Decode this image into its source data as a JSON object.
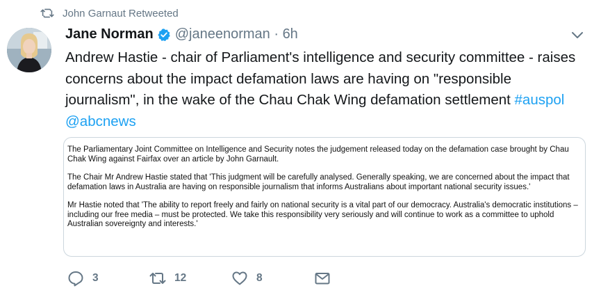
{
  "retweeted_by": "John Garnaut Retweeted",
  "tweet": {
    "author_name": "Jane Norman",
    "handle": "@janeenorman",
    "separator": " · ",
    "time": "6h",
    "text_main": "Andrew Hastie - chair of Parliament's intelligence and security committee - raises concerns about the impact defamation laws are having on \"responsible journalism\", in the wake of the Chau Chak Wing defamation settlement ",
    "hashtag": "#auspol",
    "mention": "@abcnews"
  },
  "quote": {
    "paragraphs": [
      "The Parliamentary Joint Committee on Intelligence and Security notes the judgement released today on the defamation case brought by Chau Chak Wing against Fairfax over an article by John Garnault.",
      "The Chair Mr Andrew Hastie stated that 'This judgment will be carefully analysed. Generally speaking, we are concerned about the impact that defamation laws in Australia are having on responsible journalism that informs Australians about important national security issues.'",
      "Mr Hastie noted that 'The ability to report freely and fairly on national security is a vital part of our democracy. Australia's democratic institutions – including our free media – must be protected. We take this responsibility very seriously and will continue to work as a committee to uphold Australian sovereignty and interests.'"
    ]
  },
  "actions": {
    "reply_count": "3",
    "retweet_count": "12",
    "like_count": "8"
  },
  "colors": {
    "link": "#1da1f2",
    "muted": "#657786",
    "border": "#ccd6dd"
  },
  "icons": [
    "retweet-icon",
    "verified-badge-icon",
    "chevron-down-icon",
    "reply-icon",
    "like-icon",
    "direct-message-icon"
  ]
}
